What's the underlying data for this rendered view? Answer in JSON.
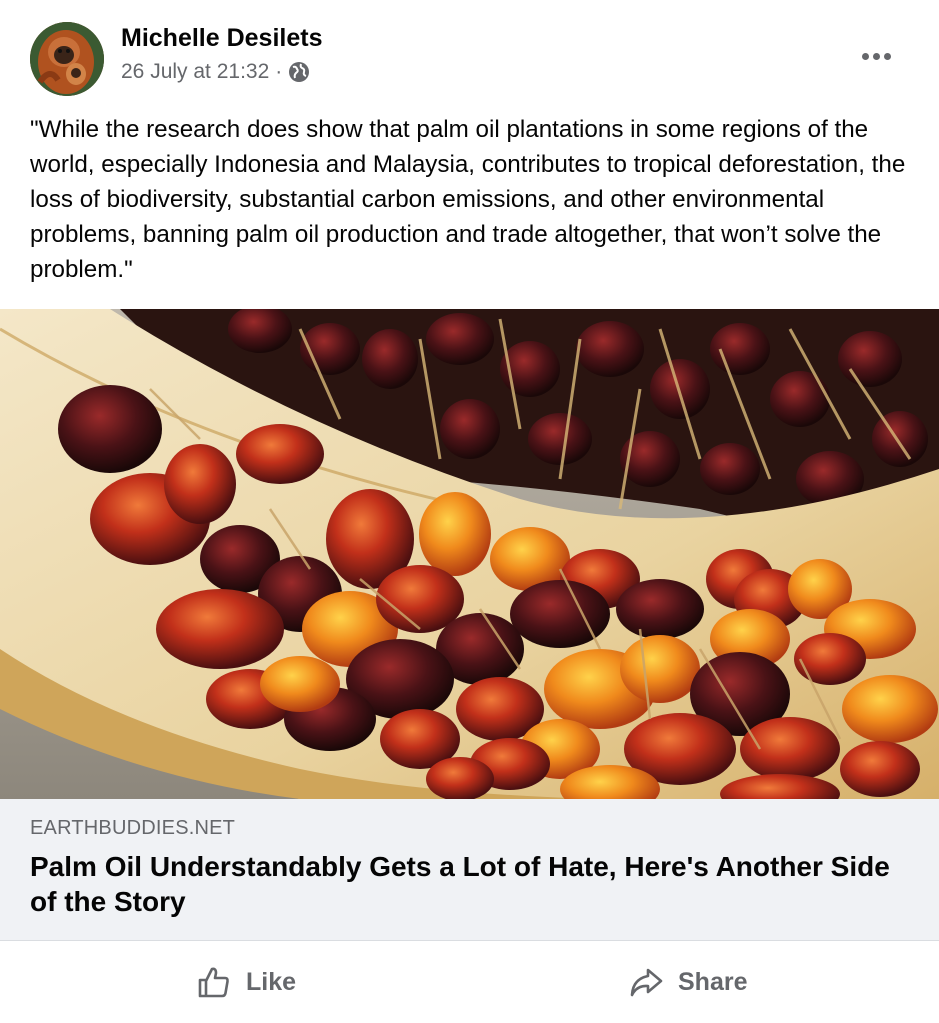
{
  "post": {
    "author": "Michelle Desilets",
    "timestamp": "26 July at 21:32",
    "separator": "·",
    "audience_icon": "globe-icon",
    "more_icon": "more-options-icon",
    "message": "\"While the research does show that palm oil plantations in some regions of the world, especially Indonesia and Malaysia, contributes to tropical deforestation, the loss of biodiversity, substantial carbon emissions, and other environmental problems, banning palm oil production and trade altogether, that won’t solve the problem.\""
  },
  "link_preview": {
    "domain": "EARTHBUDDIES.NET",
    "title": "Palm Oil Understandably Gets a Lot of Hate, Here's Another Side of the Story"
  },
  "actions": {
    "like_label": "Like",
    "like_icon": "thumbs-up-icon",
    "share_label": "Share",
    "share_icon": "share-arrow-icon"
  },
  "colors": {
    "primary_text": "#050505",
    "secondary_text": "#65676b",
    "link_box_bg": "#f0f2f5"
  }
}
